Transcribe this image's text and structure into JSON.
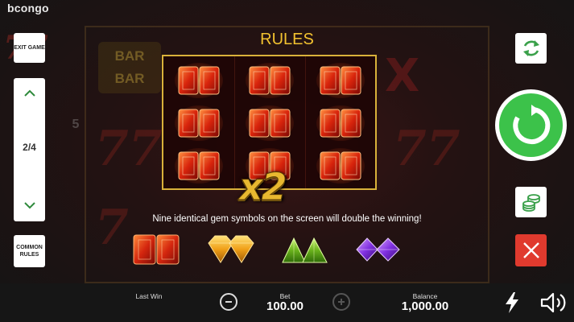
{
  "brand": {
    "name": "bcongo"
  },
  "left_panel": {
    "exit_label": "EXIT GAME",
    "page_indicator": "2/4",
    "common_rules_label": "COMMON RULES"
  },
  "rules": {
    "title": "RULES",
    "multiplier": "x2",
    "description": "Nine identical gem symbols on the screen will double the winning!",
    "grid_symbol": "red-gem",
    "grid_rows": 3,
    "grid_cols": 3,
    "gem_types": [
      "red-gem",
      "orange-gem",
      "green-gem",
      "purple-gem"
    ]
  },
  "bottom_bar": {
    "last_win_label": "Last Win",
    "bet_label": "Bet",
    "bet_value": "100.00",
    "balance_label": "Balance",
    "balance_value": "1,000.00"
  },
  "colors": {
    "accent_gold": "#f2c230",
    "spin_green": "#3cc24a",
    "close_red": "#e03a2e",
    "icon_green": "#3aa04a"
  },
  "icons": {
    "autoplay": "refresh-icon",
    "spin": "spin-icon",
    "bet": "coins-icon",
    "close": "close-icon",
    "turbo": "lightning-icon",
    "sound": "speaker-icon"
  }
}
